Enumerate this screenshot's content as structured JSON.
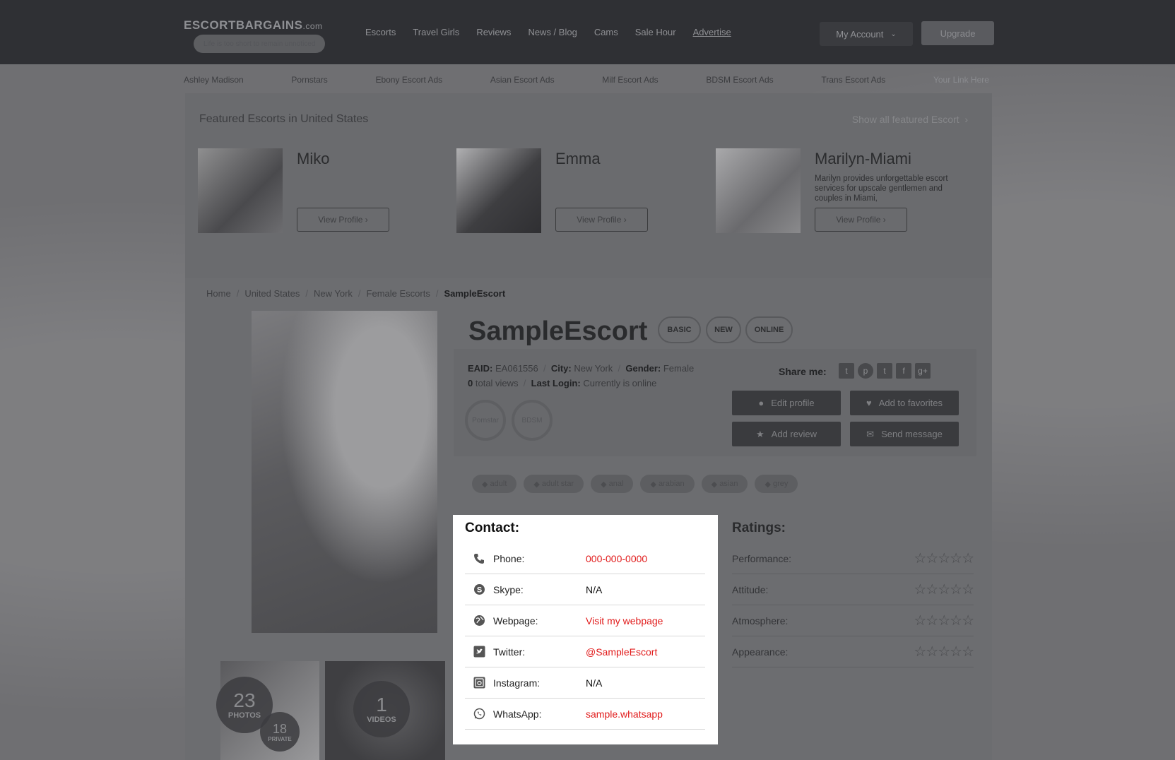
{
  "header": {
    "logo_name": "ESCORTBARGAINS",
    "logo_suffix": ".com",
    "logo_tagline": "Life is too short to remain unnoticed",
    "nav": [
      "Escorts",
      "Travel Girls",
      "Reviews",
      "News / Blog",
      "Cams",
      "Sale Hour",
      "Advertise"
    ],
    "account_label": "My Account",
    "upgrade_label": "Upgrade"
  },
  "sublinks": [
    "Ashley Madison",
    "Pornstars",
    "Ebony Escort Ads",
    "Asian Escort Ads",
    "Milf Escort Ads",
    "BDSM Escort Ads",
    "Trans Escort Ads",
    "Your Link Here"
  ],
  "featured": {
    "heading": "Featured Escorts in United States",
    "show_all": "Show all featured Escort",
    "cards": [
      {
        "name": "Miko",
        "desc": "",
        "button": "View Profile ›"
      },
      {
        "name": "Emma",
        "desc": "",
        "button": "View Profile ›"
      },
      {
        "name": "Marilyn-Miami",
        "desc": "Marilyn provides unforgettable escort services for upscale gentlemen and couples in Miami,",
        "button": "View Profile ›"
      }
    ]
  },
  "breadcrumb": [
    "Home",
    "United States",
    "New York",
    "Female Escorts",
    "SampleEscort"
  ],
  "profile": {
    "name": "SampleEscort",
    "badges": [
      "BASIC",
      "NEW",
      "ONLINE"
    ],
    "eaid_label": "EAID:",
    "eaid": "EA061556",
    "city_label": "City:",
    "city": "New York",
    "gender_label": "Gender:",
    "gender": "Female",
    "views_count": "0",
    "views_label": "total views",
    "last_login_label": "Last Login:",
    "last_login": "Currently is online",
    "share_label": "Share me:",
    "categories": [
      "Pornstar",
      "BDSM"
    ],
    "buttons": {
      "edit": "Edit profile",
      "fav": "Add to favorites",
      "review": "Add review",
      "message": "Send message"
    },
    "tags": [
      "adult",
      "adult star",
      "anal",
      "arabian",
      "asian",
      "grey"
    ],
    "media": {
      "photos_count": "23",
      "photos_label": "PHOTOS",
      "private_count": "18",
      "private_label": "PRIVATE",
      "videos_count": "1",
      "videos_label": "VIDEOS"
    }
  },
  "contact": {
    "heading": "Contact:",
    "rows": [
      {
        "icon": "phone-icon",
        "label": "Phone:",
        "value": "000-000-0000",
        "link": true
      },
      {
        "icon": "skype-icon",
        "label": "Skype:",
        "value": "N/A",
        "link": false
      },
      {
        "icon": "globe-icon",
        "label": "Webpage:",
        "value": "Visit my webpage",
        "link": true
      },
      {
        "icon": "twitter-icon",
        "label": "Twitter:",
        "value": "@SampleEscort",
        "link": true
      },
      {
        "icon": "instagram-icon",
        "label": "Instagram:",
        "value": "N/A",
        "link": false
      },
      {
        "icon": "whatsapp-icon",
        "label": "WhatsApp:",
        "value": "sample.whatsapp",
        "link": true
      }
    ]
  },
  "ratings": {
    "heading": "Ratings:",
    "rows": [
      {
        "label": "Performance:",
        "stars": 0
      },
      {
        "label": "Attitude:",
        "stars": 0
      },
      {
        "label": "Atmosphere:",
        "stars": 0
      },
      {
        "label": "Appearance:",
        "stars": 0
      }
    ]
  },
  "colors": {
    "link_red": "#e11b1b",
    "header_bg": "#2f3034",
    "overlay": "#6f6f72"
  }
}
